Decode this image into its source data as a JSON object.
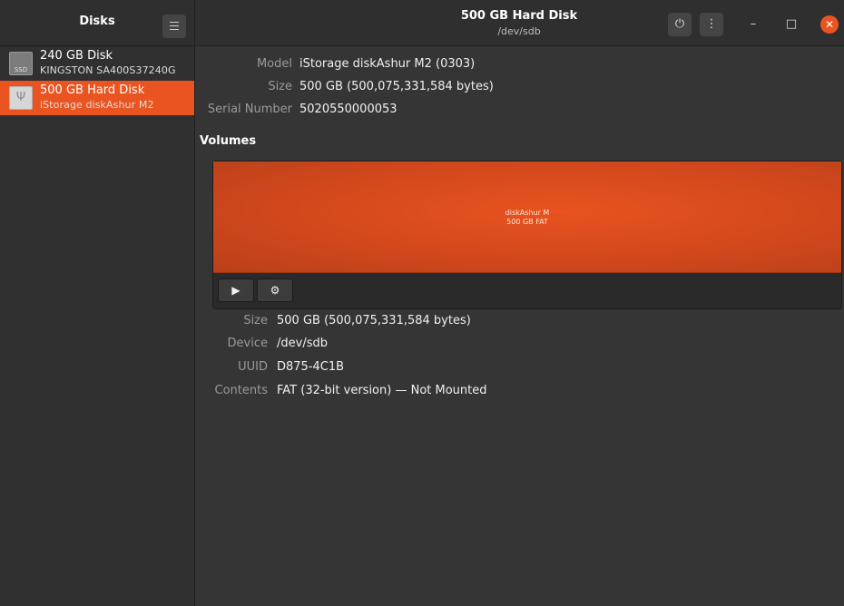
{
  "app": {
    "title": "Disks",
    "selected_disk_title": "500 GB Hard Disk",
    "selected_disk_path": "/dev/sdb"
  },
  "header": {
    "menu_icon": "hamburger-icon",
    "power_icon": "power-icon",
    "more_icon": "more-vertical-icon",
    "minimize_icon": "minimize-icon",
    "maximize_icon": "maximize-icon",
    "close_icon": "close-icon"
  },
  "sidebar": {
    "disks": [
      {
        "name": "240 GB Disk",
        "model": "KINGSTON SA400S37240G",
        "icon": "ssd-icon",
        "icon_label": "SSD",
        "selected": false
      },
      {
        "name": "500 GB Hard Disk",
        "model": "iStorage diskAshur M2",
        "icon": "usb-drive-icon",
        "selected": true
      }
    ]
  },
  "drive_info": {
    "model_label": "Model",
    "model_value": "iStorage diskAshur M2 (0303)",
    "size_label": "Size",
    "size_value": "500 GB (500,075,331,584 bytes)",
    "serial_label": "Serial Number",
    "serial_value": "5020550000053"
  },
  "volumes": {
    "section_title": "Volumes",
    "block": {
      "line1": "diskAshur M",
      "line2": "500 GB FAT"
    },
    "play_icon": "play-icon",
    "settings_icon": "gears-icon"
  },
  "volume_info": {
    "size_label": "Size",
    "size_value": "500 GB (500,075,331,584 bytes)",
    "device_label": "Device",
    "device_value": "/dev/sdb",
    "uuid_label": "UUID",
    "uuid_value": "D875-4C1B",
    "contents_label": "Contents",
    "contents_value": "FAT (32-bit version) — Not Mounted"
  },
  "colors": {
    "accent": "#e95420",
    "background": "#353535",
    "sidebar": "#303030"
  }
}
